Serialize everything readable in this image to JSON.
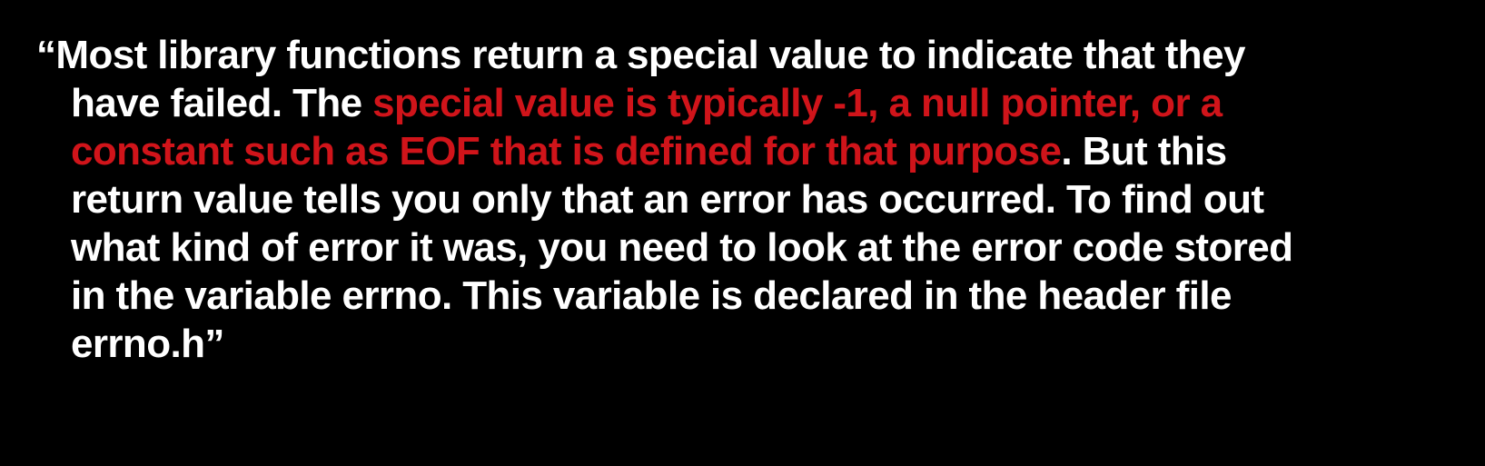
{
  "colors": {
    "background": "#000000",
    "text": "#ffffff",
    "highlight": "#d0141a"
  },
  "quote": {
    "line1": "“Most library functions return a special value to indicate that they",
    "line2_plain": "have failed. The ",
    "line2_red": "special value is typically -1, a null pointer, or a",
    "line3_red": "constant such as EOF that is defined for that purpose",
    "line3_plain": ". But this",
    "line4": "return value tells you only that an error has occurred. To find out",
    "line5": "what kind of error it was, you need to look at the error code stored",
    "line6": "in the variable errno. This variable is declared in the header file",
    "line7": "errno.h”"
  }
}
